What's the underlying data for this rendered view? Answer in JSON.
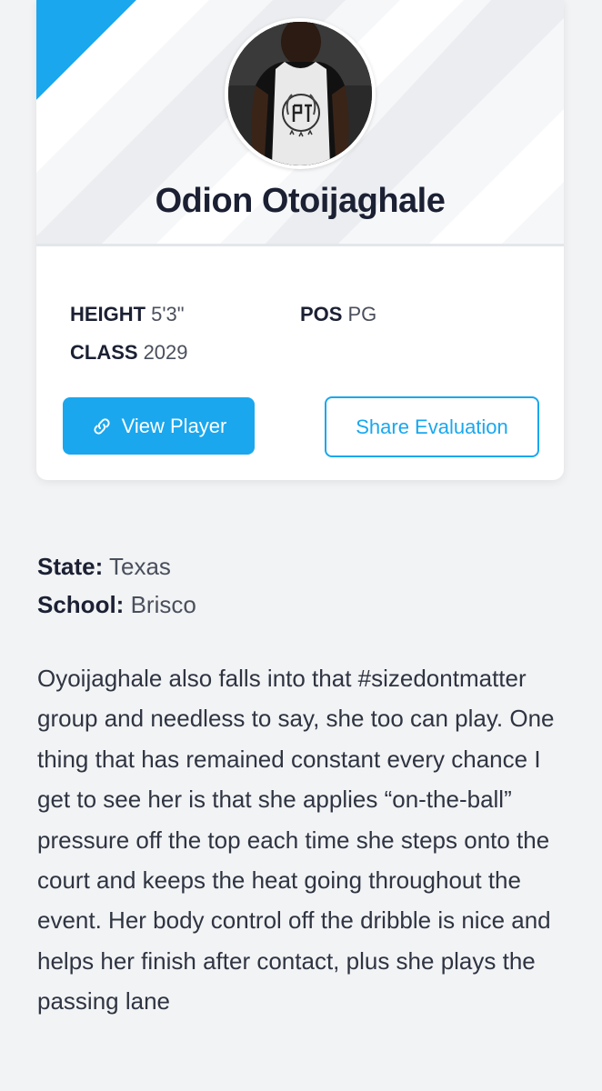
{
  "player": {
    "name": "Odion Otoijaghale",
    "stats": {
      "height_label": "HEIGHT",
      "height_value": "5'3\"",
      "pos_label": "POS",
      "pos_value": "PG",
      "class_label": "CLASS",
      "class_value": "2029"
    }
  },
  "actions": {
    "view_player_label": "View Player",
    "share_label": "Share Evaluation"
  },
  "details": {
    "state_label": "State:",
    "state_value": "Texas",
    "school_label": "School:",
    "school_value": "Brisco"
  },
  "evaluation": {
    "text": "Oyoijaghale also falls into that #sizedontmatter group and needless to say, she too can play. One thing that has remained constant every chance I get to see her is that she applies “on-the-ball” pressure off the top each time she steps onto the court and keeps the heat going throughout the event. Her body control off the dribble is nice and helps her finish after contact, plus she plays the passing lane"
  },
  "colors": {
    "accent": "#1aa7ee",
    "text_dark": "#1b2033",
    "text_muted": "#4a4f5c",
    "page_bg": "#f2f3f5"
  },
  "icons": {
    "view_player_icon": "link-icon"
  }
}
